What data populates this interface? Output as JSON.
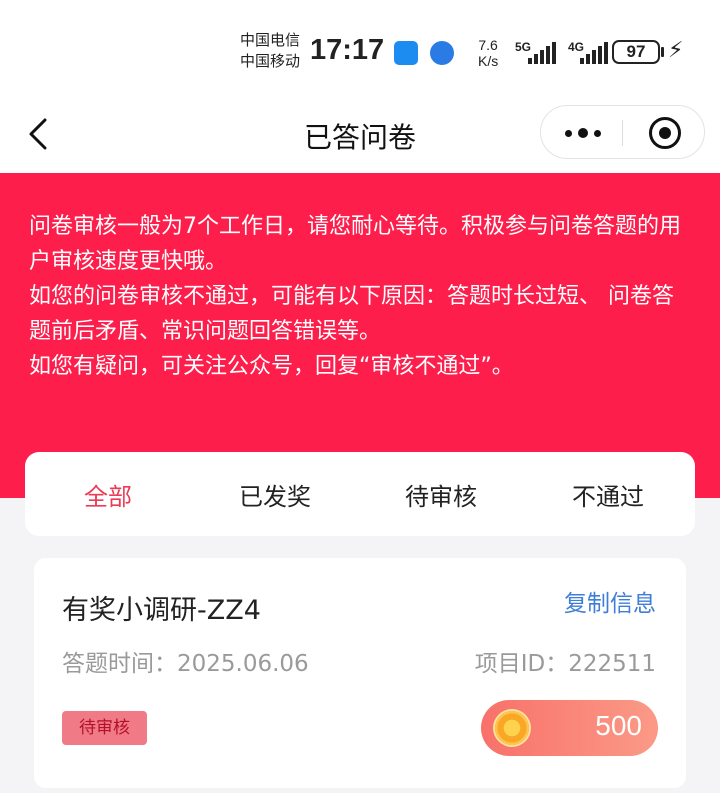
{
  "status_bar": {
    "carrier_1": "中国电信",
    "carrier_2": "中国移动",
    "time": "17:17",
    "speed_value": "7.6",
    "speed_unit": "K/s",
    "network_1": "5G",
    "network_2": "4G",
    "battery": "97"
  },
  "nav": {
    "title": "已答问卷"
  },
  "notice": {
    "lines": [
      "问卷审核一般为7个工作日，请您耐心等待。积极参与问卷答题的用户审核速度更快哦。",
      "如您的问卷审核不通过，可能有以下原因：答题时长过短、 问卷答题前后矛盾、常识问题回答错误等。",
      "如您有疑问，可关注公众号，回复“审核不通过”。"
    ]
  },
  "tabs": [
    {
      "label": "全部",
      "active": true
    },
    {
      "label": "已发奖",
      "active": false
    },
    {
      "label": "待审核",
      "active": false
    },
    {
      "label": "不通过",
      "active": false
    }
  ],
  "survey": {
    "title": "有奖小调研-ZZ4",
    "copy_label": "复制信息",
    "answer_time": "答题时间：2025.06.06",
    "project_id": "项目ID：222511",
    "status": "待审核",
    "reward": "500"
  },
  "colors": {
    "banner": "#fd1e4b",
    "active_tab": "#ec3c54",
    "link": "#3f7ed8",
    "badge_bg": "#f07a86"
  }
}
